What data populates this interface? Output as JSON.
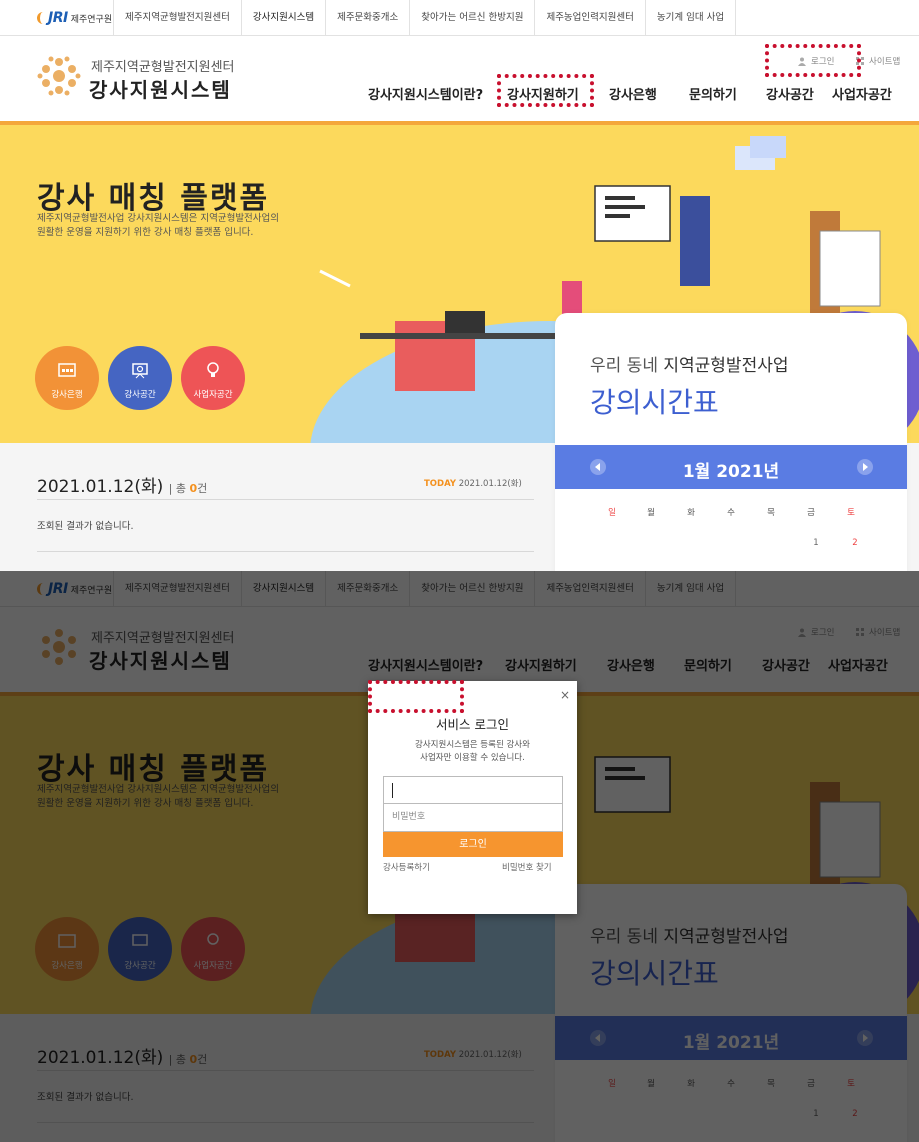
{
  "sitebar": {
    "logo_mark": "JRI",
    "logo_text": "제주연구원",
    "tabs": [
      "제주지역균형발전지원센터",
      "강사지원시스템",
      "제주문화중개소",
      "찾아가는 어르신 한방지원",
      "제주농업인력지원센터",
      "농기계 임대 사업"
    ]
  },
  "header": {
    "logo_sub": "제주지역균형발전지원센터",
    "logo_main": "강사지원시스템",
    "login_label": "로그인",
    "sitemap_label": "사이트맵",
    "nav": [
      "강사지원시스템이란?",
      "강사지원하기",
      "강사은행",
      "문의하기",
      "강사공간",
      "사업자공간"
    ]
  },
  "hero": {
    "title": "강사 매칭 플랫폼",
    "desc_line1": "제주지역균형발전사업 강사지원시스템은 지역균형발전사업의",
    "desc_line2": "원활한 운영을 지원하기 위한 강사 매칭 플랫폼 입니다.",
    "quick": [
      "강사은행",
      "강사공간",
      "사업자공간"
    ]
  },
  "schedule": {
    "date": "2021.01.12(화)",
    "total_label": "총",
    "total_count": "0",
    "total_unit": "건",
    "today_label": "TODAY",
    "today_date": "2021.01.12(화)",
    "no_result": "조회된 결과가 없습니다."
  },
  "timetable": {
    "sub_light": "우리 동네",
    "sub_bold": "지역균형발전사업",
    "title": "강의시간표",
    "month": "1월 2021년",
    "weekdays": [
      "일",
      "월",
      "화",
      "수",
      "목",
      "금",
      "토"
    ],
    "days": [
      "1",
      "2"
    ]
  },
  "login_modal": {
    "close": "×",
    "title": "서비스 로그인",
    "desc_line1": "강사지원시스템은 등록된 강사와",
    "desc_line2": "사업자만 이용할 수 있습니다.",
    "id_value": "",
    "pw_placeholder": "비밀번호",
    "submit": "로그인",
    "register": "강사등록하기",
    "find_pw": "비밀번호 찾기"
  },
  "colors": {
    "hero_bg": "#fcd95c",
    "accent_orange": "#f6952f",
    "calendar_blue": "#5a7ce3",
    "highlight": "#c8102e"
  }
}
